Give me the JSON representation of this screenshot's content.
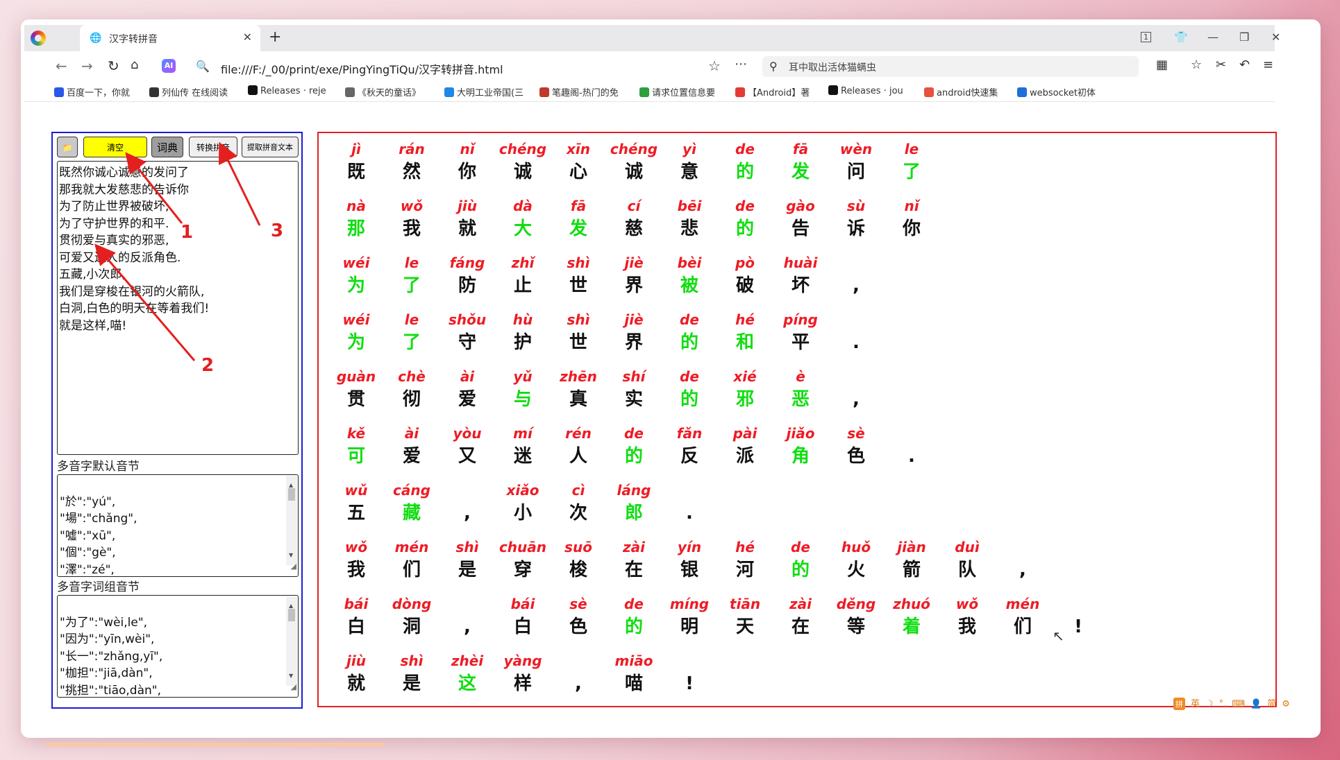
{
  "tab": {
    "title": "汉字转拼音"
  },
  "toolbar": {
    "url": "file:///F:/_00/print/exe/PingYingTiQu/汉字转拼音.html",
    "ai_label": "AI",
    "search_text": "耳中取出活体猫螨虫",
    "tab_count": "1"
  },
  "bookmarks": [
    {
      "label": "百度一下，你就",
      "icon": "paw-icon",
      "color": "#2b57e8"
    },
    {
      "label": "列仙传 在线阅读",
      "icon": "book-icon",
      "color": "#333333"
    },
    {
      "label": "Releases · reje",
      "icon": "github-icon",
      "color": "#111111"
    },
    {
      "label": "《秋天的童话》",
      "icon": "globe-icon",
      "color": "#666666"
    },
    {
      "label": "大明工业帝国(三",
      "icon": "bird-icon",
      "color": "#1e88e5"
    },
    {
      "label": "笔趣阁-热门的免",
      "icon": "house-icon",
      "color": "#c0392b"
    },
    {
      "label": "请求位置信息要",
      "icon": "android-icon",
      "color": "#2e9e3e"
    },
    {
      "label": "【Android】著",
      "icon": "c-icon",
      "color": "#e53935"
    },
    {
      "label": "Releases · jou",
      "icon": "github-icon",
      "color": "#111111"
    },
    {
      "label": "android快速集",
      "icon": "jian-icon",
      "color": "#e5533d"
    },
    {
      "label": "websocket初体",
      "icon": "circle-icon",
      "color": "#1e6fd9"
    }
  ],
  "buttons": {
    "folder": "📁",
    "clear": "清空",
    "dict": "词典",
    "convert": "转换拼音",
    "extract": "提取拼音文本"
  },
  "input_text": "既然你诚心诚意的发问了\n那我就大发慈悲的告诉你\n为了防止世界被破坏,\n为了守护世界的和平.\n贯彻爱与真实的邪恶,\n可爱又迷人的反派角色.\n五藏,小次郎,\n我们是穿梭在银河的火箭队,\n白洞,白色的明天在等着我们!\n就是这样,喵!",
  "default_syllables_label": "多音字默认音节",
  "default_syllables_text": "\"於\":\"yú\",\n\"場\":\"chǎng\",\n\"噓\":\"xū\",\n\"個\":\"gè\",\n\"澤\":\"zé\",\n\"斬\":\"zhǎn\",",
  "phrase_syllables_label": "多音字词组音节",
  "phrase_syllables_text": "\"为了\":\"wèi,le\",\n\"因为\":\"yīn,wèi\",\n\"长一\":\"zhǎng,yī\",\n\"枷担\":\"jiā,dàn\",\n\"挑担\":\"tiāo,dàn\",\n\"易宿\":\"yì,xiǔ\",",
  "annotations": [
    "1",
    "2",
    "3"
  ],
  "ime": {
    "logo": "拼",
    "items": [
      "英",
      "☽",
      "°,",
      "⌨",
      "👤",
      "简",
      "⚙"
    ]
  },
  "pinyin_rows": [
    [
      [
        "jì",
        "既",
        "b"
      ],
      [
        "rán",
        "然",
        "b"
      ],
      [
        "nǐ",
        "你",
        "b"
      ],
      [
        "chéng",
        "诚",
        "b"
      ],
      [
        "xīn",
        "心",
        "b"
      ],
      [
        "chéng",
        "诚",
        "b"
      ],
      [
        "yì",
        "意",
        "b"
      ],
      [
        "de",
        "的",
        "g"
      ],
      [
        "fā",
        "发",
        "g"
      ],
      [
        "wèn",
        "问",
        "b"
      ],
      [
        "le",
        "了",
        "g"
      ]
    ],
    [
      [
        "nà",
        "那",
        "g"
      ],
      [
        "wǒ",
        "我",
        "b"
      ],
      [
        "jiù",
        "就",
        "b"
      ],
      [
        "dà",
        "大",
        "g"
      ],
      [
        "fā",
        "发",
        "g"
      ],
      [
        "cí",
        "慈",
        "b"
      ],
      [
        "bēi",
        "悲",
        "b"
      ],
      [
        "de",
        "的",
        "g"
      ],
      [
        "gào",
        "告",
        "b"
      ],
      [
        "sù",
        "诉",
        "b"
      ],
      [
        "nǐ",
        "你",
        "b"
      ]
    ],
    [
      [
        "wéi",
        "为",
        "g"
      ],
      [
        "le",
        "了",
        "g"
      ],
      [
        "fáng",
        "防",
        "b"
      ],
      [
        "zhǐ",
        "止",
        "b"
      ],
      [
        "shì",
        "世",
        "b"
      ],
      [
        "jiè",
        "界",
        "b"
      ],
      [
        "bèi",
        "被",
        "g"
      ],
      [
        "pò",
        "破",
        "b"
      ],
      [
        "huài",
        "坏",
        "b"
      ],
      [
        "",
        ",",
        "b"
      ]
    ],
    [
      [
        "wéi",
        "为",
        "g"
      ],
      [
        "le",
        "了",
        "g"
      ],
      [
        "shǒu",
        "守",
        "b"
      ],
      [
        "hù",
        "护",
        "b"
      ],
      [
        "shì",
        "世",
        "b"
      ],
      [
        "jiè",
        "界",
        "b"
      ],
      [
        "de",
        "的",
        "g"
      ],
      [
        "hé",
        "和",
        "g"
      ],
      [
        "píng",
        "平",
        "b"
      ],
      [
        "",
        ".",
        "b"
      ]
    ],
    [
      [
        "guàn",
        "贯",
        "b"
      ],
      [
        "chè",
        "彻",
        "b"
      ],
      [
        "ài",
        "爱",
        "b"
      ],
      [
        "yǔ",
        "与",
        "g"
      ],
      [
        "zhēn",
        "真",
        "b"
      ],
      [
        "shí",
        "实",
        "b"
      ],
      [
        "de",
        "的",
        "g"
      ],
      [
        "xié",
        "邪",
        "g"
      ],
      [
        "è",
        "恶",
        "g"
      ],
      [
        "",
        ",",
        "b"
      ]
    ],
    [
      [
        "kě",
        "可",
        "g"
      ],
      [
        "ài",
        "爱",
        "b"
      ],
      [
        "yòu",
        "又",
        "b"
      ],
      [
        "mí",
        "迷",
        "b"
      ],
      [
        "rén",
        "人",
        "b"
      ],
      [
        "de",
        "的",
        "g"
      ],
      [
        "fǎn",
        "反",
        "b"
      ],
      [
        "pài",
        "派",
        "b"
      ],
      [
        "jiǎo",
        "角",
        "g"
      ],
      [
        "sè",
        "色",
        "b"
      ],
      [
        "",
        ".",
        "b"
      ]
    ],
    [
      [
        "wǔ",
        "五",
        "b"
      ],
      [
        "cáng",
        "藏",
        "g"
      ],
      [
        "",
        ",",
        "b"
      ],
      [
        "xiǎo",
        "小",
        "b"
      ],
      [
        "cì",
        "次",
        "b"
      ],
      [
        "láng",
        "郎",
        "g"
      ],
      [
        "",
        ".",
        "b"
      ]
    ],
    [
      [
        "wǒ",
        "我",
        "b"
      ],
      [
        "mén",
        "们",
        "b"
      ],
      [
        "shì",
        "是",
        "b"
      ],
      [
        "chuān",
        "穿",
        "b"
      ],
      [
        "suō",
        "梭",
        "b"
      ],
      [
        "zài",
        "在",
        "b"
      ],
      [
        "yín",
        "银",
        "b"
      ],
      [
        "hé",
        "河",
        "b"
      ],
      [
        "de",
        "的",
        "g"
      ],
      [
        "huǒ",
        "火",
        "b"
      ],
      [
        "jiàn",
        "箭",
        "b"
      ],
      [
        "duì",
        "队",
        "b"
      ],
      [
        "",
        ",",
        "b"
      ]
    ],
    [
      [
        "bái",
        "白",
        "b"
      ],
      [
        "dòng",
        "洞",
        "b"
      ],
      [
        "",
        ",",
        "b"
      ],
      [
        "bái",
        "白",
        "b"
      ],
      [
        "sè",
        "色",
        "b"
      ],
      [
        "de",
        "的",
        "g"
      ],
      [
        "míng",
        "明",
        "b"
      ],
      [
        "tiān",
        "天",
        "b"
      ],
      [
        "zài",
        "在",
        "b"
      ],
      [
        "děng",
        "等",
        "b"
      ],
      [
        "zhuó",
        "着",
        "g"
      ],
      [
        "wǒ",
        "我",
        "b"
      ],
      [
        "mén",
        "们",
        "b"
      ],
      [
        "",
        "!",
        "b"
      ]
    ],
    [
      [
        "jiù",
        "就",
        "b"
      ],
      [
        "shì",
        "是",
        "b"
      ],
      [
        "zhèi",
        "这",
        "g"
      ],
      [
        "yàng",
        "样",
        "b"
      ],
      [
        "",
        ",",
        "b"
      ],
      [
        "miāo",
        "喵",
        "b"
      ],
      [
        "",
        "!",
        "b"
      ]
    ]
  ]
}
